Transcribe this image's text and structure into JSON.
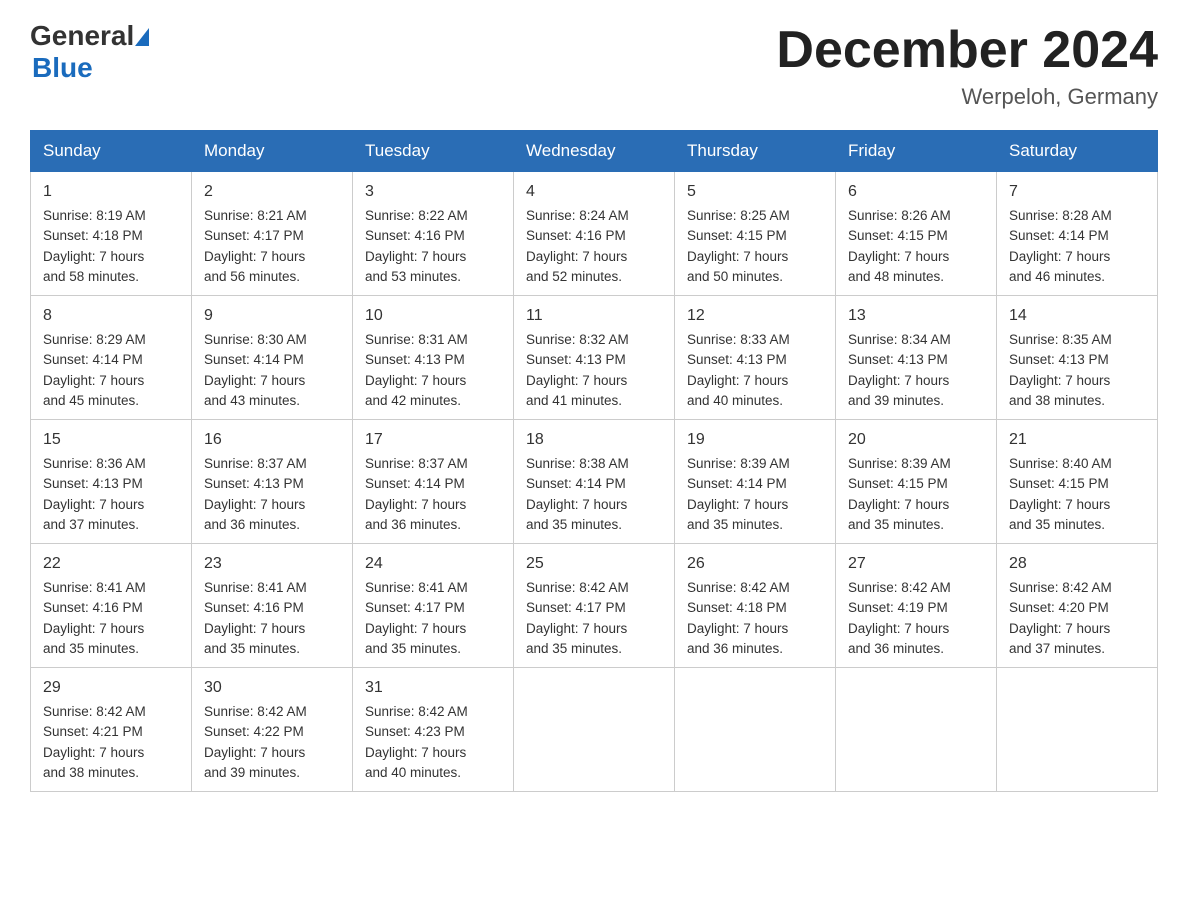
{
  "header": {
    "logo_text1": "General",
    "logo_text2": "Blue",
    "month_title": "December 2024",
    "location": "Werpeloh, Germany"
  },
  "days_of_week": [
    "Sunday",
    "Monday",
    "Tuesday",
    "Wednesday",
    "Thursday",
    "Friday",
    "Saturday"
  ],
  "weeks": [
    [
      {
        "day": "1",
        "sunrise": "8:19 AM",
        "sunset": "4:18 PM",
        "daylight": "7 hours and 58 minutes."
      },
      {
        "day": "2",
        "sunrise": "8:21 AM",
        "sunset": "4:17 PM",
        "daylight": "7 hours and 56 minutes."
      },
      {
        "day": "3",
        "sunrise": "8:22 AM",
        "sunset": "4:16 PM",
        "daylight": "7 hours and 53 minutes."
      },
      {
        "day": "4",
        "sunrise": "8:24 AM",
        "sunset": "4:16 PM",
        "daylight": "7 hours and 52 minutes."
      },
      {
        "day": "5",
        "sunrise": "8:25 AM",
        "sunset": "4:15 PM",
        "daylight": "7 hours and 50 minutes."
      },
      {
        "day": "6",
        "sunrise": "8:26 AM",
        "sunset": "4:15 PM",
        "daylight": "7 hours and 48 minutes."
      },
      {
        "day": "7",
        "sunrise": "8:28 AM",
        "sunset": "4:14 PM",
        "daylight": "7 hours and 46 minutes."
      }
    ],
    [
      {
        "day": "8",
        "sunrise": "8:29 AM",
        "sunset": "4:14 PM",
        "daylight": "7 hours and 45 minutes."
      },
      {
        "day": "9",
        "sunrise": "8:30 AM",
        "sunset": "4:14 PM",
        "daylight": "7 hours and 43 minutes."
      },
      {
        "day": "10",
        "sunrise": "8:31 AM",
        "sunset": "4:13 PM",
        "daylight": "7 hours and 42 minutes."
      },
      {
        "day": "11",
        "sunrise": "8:32 AM",
        "sunset": "4:13 PM",
        "daylight": "7 hours and 41 minutes."
      },
      {
        "day": "12",
        "sunrise": "8:33 AM",
        "sunset": "4:13 PM",
        "daylight": "7 hours and 40 minutes."
      },
      {
        "day": "13",
        "sunrise": "8:34 AM",
        "sunset": "4:13 PM",
        "daylight": "7 hours and 39 minutes."
      },
      {
        "day": "14",
        "sunrise": "8:35 AM",
        "sunset": "4:13 PM",
        "daylight": "7 hours and 38 minutes."
      }
    ],
    [
      {
        "day": "15",
        "sunrise": "8:36 AM",
        "sunset": "4:13 PM",
        "daylight": "7 hours and 37 minutes."
      },
      {
        "day": "16",
        "sunrise": "8:37 AM",
        "sunset": "4:13 PM",
        "daylight": "7 hours and 36 minutes."
      },
      {
        "day": "17",
        "sunrise": "8:37 AM",
        "sunset": "4:14 PM",
        "daylight": "7 hours and 36 minutes."
      },
      {
        "day": "18",
        "sunrise": "8:38 AM",
        "sunset": "4:14 PM",
        "daylight": "7 hours and 35 minutes."
      },
      {
        "day": "19",
        "sunrise": "8:39 AM",
        "sunset": "4:14 PM",
        "daylight": "7 hours and 35 minutes."
      },
      {
        "day": "20",
        "sunrise": "8:39 AM",
        "sunset": "4:15 PM",
        "daylight": "7 hours and 35 minutes."
      },
      {
        "day": "21",
        "sunrise": "8:40 AM",
        "sunset": "4:15 PM",
        "daylight": "7 hours and 35 minutes."
      }
    ],
    [
      {
        "day": "22",
        "sunrise": "8:41 AM",
        "sunset": "4:16 PM",
        "daylight": "7 hours and 35 minutes."
      },
      {
        "day": "23",
        "sunrise": "8:41 AM",
        "sunset": "4:16 PM",
        "daylight": "7 hours and 35 minutes."
      },
      {
        "day": "24",
        "sunrise": "8:41 AM",
        "sunset": "4:17 PM",
        "daylight": "7 hours and 35 minutes."
      },
      {
        "day": "25",
        "sunrise": "8:42 AM",
        "sunset": "4:17 PM",
        "daylight": "7 hours and 35 minutes."
      },
      {
        "day": "26",
        "sunrise": "8:42 AM",
        "sunset": "4:18 PM",
        "daylight": "7 hours and 36 minutes."
      },
      {
        "day": "27",
        "sunrise": "8:42 AM",
        "sunset": "4:19 PM",
        "daylight": "7 hours and 36 minutes."
      },
      {
        "day": "28",
        "sunrise": "8:42 AM",
        "sunset": "4:20 PM",
        "daylight": "7 hours and 37 minutes."
      }
    ],
    [
      {
        "day": "29",
        "sunrise": "8:42 AM",
        "sunset": "4:21 PM",
        "daylight": "7 hours and 38 minutes."
      },
      {
        "day": "30",
        "sunrise": "8:42 AM",
        "sunset": "4:22 PM",
        "daylight": "7 hours and 39 minutes."
      },
      {
        "day": "31",
        "sunrise": "8:42 AM",
        "sunset": "4:23 PM",
        "daylight": "7 hours and 40 minutes."
      },
      null,
      null,
      null,
      null
    ]
  ],
  "labels": {
    "sunrise": "Sunrise:",
    "sunset": "Sunset:",
    "daylight": "Daylight:"
  }
}
